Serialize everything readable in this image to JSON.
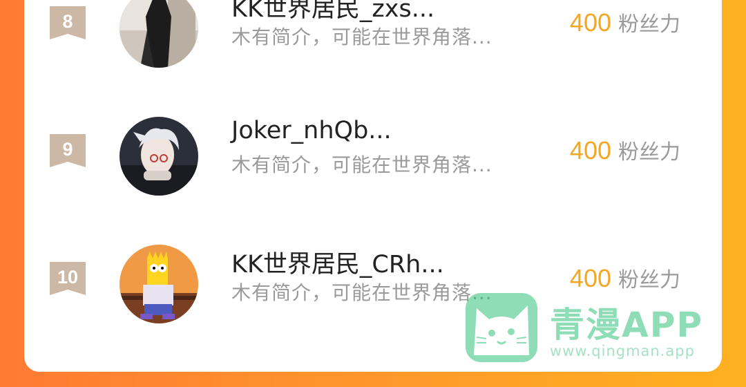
{
  "list": {
    "items": [
      {
        "rank": "8",
        "name": "KK世界居民_zxs...",
        "bio": "木有简介，可能在世界角落...",
        "score": "400",
        "unit": "粉丝力"
      },
      {
        "rank": "9",
        "name": "Joker_nhQb...",
        "bio": "木有简介，可能在世界角落...",
        "score": "400",
        "unit": "粉丝力"
      },
      {
        "rank": "10",
        "name": "KK世界居民_CRh...",
        "bio": "木有简介，可能在世界角落...",
        "score": "400",
        "unit": "粉丝力"
      }
    ]
  },
  "watermark": {
    "title": "青漫APP",
    "url": "www.qingman.app"
  },
  "colors": {
    "score": "#f5a623",
    "rank_badge": "#cdb7a5",
    "watermark": "#33c27c",
    "background_start": "#ff7a33",
    "background_end": "#ffb11f"
  },
  "icons": {
    "rank_badge": "ribbon-badge-icon",
    "watermark_logo": "cat-face-icon"
  }
}
